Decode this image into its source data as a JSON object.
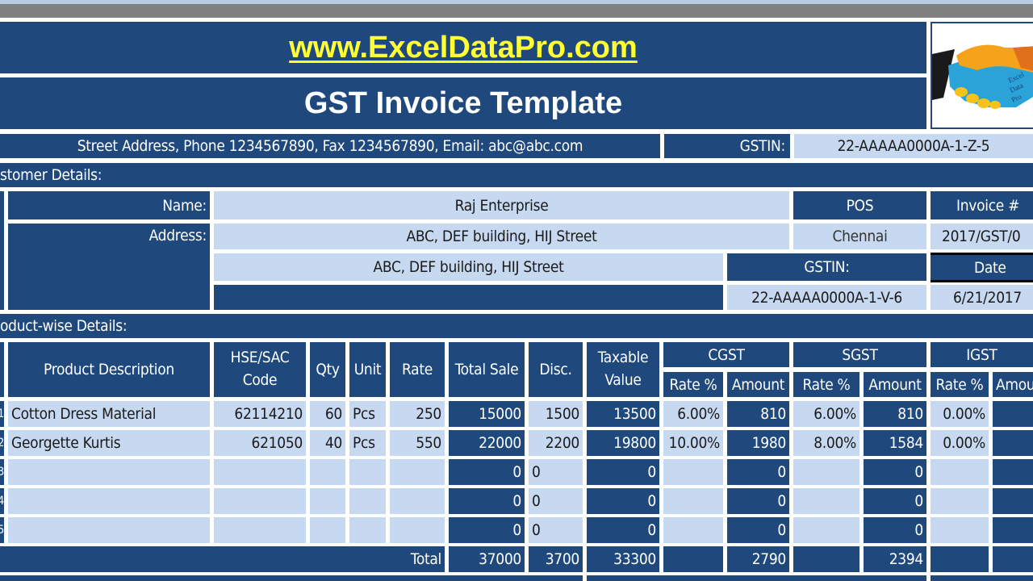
{
  "header": {
    "website": "www.ExcelDataPro.com",
    "title": "GST Invoice Template",
    "company_info": "Street Address, Phone 1234567890, Fax 1234567890, Email: abc@abc.com",
    "gstin_label": "GSTIN:",
    "gstin_value": "22-AAAAA0000A-1-Z-5",
    "logo_icon": "handshake-icon"
  },
  "customer": {
    "section_label": "stomer Details:",
    "name_label": "Name:",
    "name_value": "Raj Enterprise",
    "address_label": "Address:",
    "address_line1": "ABC, DEF building, HIJ Street",
    "address_line2": "ABC, DEF building, HIJ Street",
    "address_line3": "",
    "pos_label": "POS",
    "pos_value": "Chennai",
    "gstin_label": "GSTIN:",
    "gstin_value": "22-AAAAA0000A-1-V-6",
    "invoice_label": "Invoice #",
    "invoice_value": "2017/GST/0",
    "date_label": "Date",
    "date_value": "6/21/2017"
  },
  "products": {
    "section_label": "oduct-wise Details:",
    "columns": {
      "description": "Product Description",
      "hsn": "HSE/SAC Code",
      "qty": "Qty",
      "unit": "Unit",
      "rate": "Rate",
      "total_sale": "Total Sale",
      "disc": "Disc.",
      "taxable": "Taxable Value",
      "cgst": "CGST",
      "sgst": "SGST",
      "igst": "IGST",
      "rate_pct": "Rate %",
      "amount": "Amount",
      "amount_partial": "Amou"
    },
    "rows": [
      {
        "sr": "1",
        "description": "Cotton Dress Material",
        "hsn": "62114210",
        "qty": "60",
        "unit": "Pcs",
        "rate": "250",
        "total_sale": "15000",
        "disc": "1500",
        "taxable": "13500",
        "cgst_rate": "6.00%",
        "cgst_amt": "810",
        "sgst_rate": "6.00%",
        "sgst_amt": "810",
        "igst_rate": "0.00%",
        "igst_amt": ""
      },
      {
        "sr": "2",
        "description": "Georgette Kurtis",
        "hsn": "621050",
        "qty": "40",
        "unit": "Pcs",
        "rate": "550",
        "total_sale": "22000",
        "disc": "2200",
        "taxable": "19800",
        "cgst_rate": "10.00%",
        "cgst_amt": "1980",
        "sgst_rate": "8.00%",
        "sgst_amt": "1584",
        "igst_rate": "0.00%",
        "igst_amt": ""
      },
      {
        "sr": "3",
        "description": "",
        "hsn": "",
        "qty": "",
        "unit": "",
        "rate": "",
        "total_sale": "0",
        "disc": "0",
        "taxable": "0",
        "cgst_rate": "",
        "cgst_amt": "0",
        "sgst_rate": "",
        "sgst_amt": "0",
        "igst_rate": "",
        "igst_amt": ""
      },
      {
        "sr": "4",
        "description": "",
        "hsn": "",
        "qty": "",
        "unit": "",
        "rate": "",
        "total_sale": "0",
        "disc": "0",
        "taxable": "0",
        "cgst_rate": "",
        "cgst_amt": "0",
        "sgst_rate": "",
        "sgst_amt": "0",
        "igst_rate": "",
        "igst_amt": ""
      },
      {
        "sr": "5",
        "description": "",
        "hsn": "",
        "qty": "",
        "unit": "",
        "rate": "",
        "total_sale": "0",
        "disc": "0",
        "taxable": "0",
        "cgst_rate": "",
        "cgst_amt": "0",
        "sgst_rate": "",
        "sgst_amt": "0",
        "igst_rate": "",
        "igst_amt": ""
      }
    ],
    "totals": {
      "label": "Total",
      "total_sale": "37000",
      "disc": "3700",
      "taxable": "33300",
      "cgst_amt": "2790",
      "sgst_amt": "2394"
    }
  },
  "colors": {
    "dark_blue": "#1f497d",
    "light_blue": "#c6d9f0",
    "website_yellow": "#ffff33"
  }
}
